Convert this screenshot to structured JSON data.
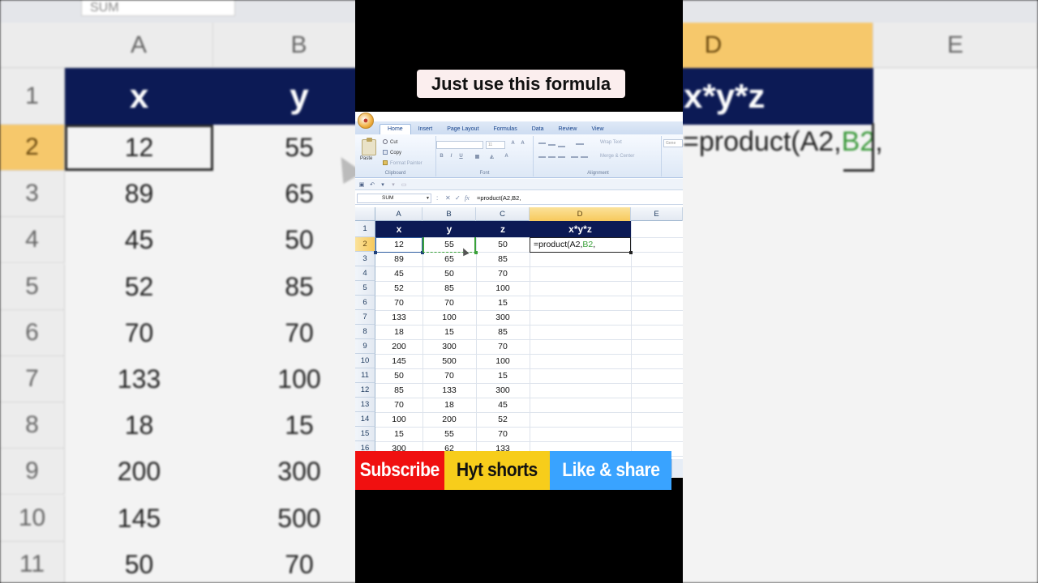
{
  "caption": "Just use this formula",
  "ribbon": {
    "tabs": [
      "Home",
      "Insert",
      "Page Layout",
      "Formulas",
      "Data",
      "Review",
      "View"
    ],
    "clipboard": {
      "paste_label": "Paste",
      "cut_label": "Cut",
      "copy_label": "Copy",
      "format_painter_label": "Format Painter",
      "group_label": "Clipboard"
    },
    "font": {
      "size_value": "11",
      "group_label": "Font"
    },
    "alignment": {
      "wrap_text_label": "Wrap Text",
      "merge_label": "Merge & Center",
      "group_label": "Alignment"
    },
    "number_format_value": "Gene"
  },
  "formula_bar": {
    "name_box": "SUM",
    "fx_label": "fx",
    "formula": "=product(A2,B2,"
  },
  "sheet": {
    "columns": [
      "A",
      "B",
      "C",
      "D",
      "E"
    ],
    "active_column": "D",
    "active_row": "2",
    "header_row": {
      "a": "x",
      "b": "y",
      "c": "z",
      "d": "x*y*z"
    },
    "editing_cell": {
      "text_prefix": "=product(A2,",
      "text_ref_b": "B2",
      "text_suffix": ","
    },
    "rows": [
      {
        "n": "1"
      },
      {
        "n": "2",
        "a": "12",
        "b": "55",
        "c": "50"
      },
      {
        "n": "3",
        "a": "89",
        "b": "65",
        "c": "85"
      },
      {
        "n": "4",
        "a": "45",
        "b": "50",
        "c": "70"
      },
      {
        "n": "5",
        "a": "52",
        "b": "85",
        "c": "100"
      },
      {
        "n": "6",
        "a": "70",
        "b": "70",
        "c": "15"
      },
      {
        "n": "7",
        "a": "133",
        "b": "100",
        "c": "300"
      },
      {
        "n": "8",
        "a": "18",
        "b": "15",
        "c": "85"
      },
      {
        "n": "9",
        "a": "200",
        "b": "300",
        "c": "70"
      },
      {
        "n": "10",
        "a": "145",
        "b": "500",
        "c": "100"
      },
      {
        "n": "11",
        "a": "50",
        "b": "70",
        "c": "15"
      },
      {
        "n": "12",
        "a": "85",
        "b": "133",
        "c": "300"
      },
      {
        "n": "13",
        "a": "70",
        "b": "18",
        "c": "45"
      },
      {
        "n": "14",
        "a": "100",
        "b": "200",
        "c": "52"
      },
      {
        "n": "15",
        "a": "15",
        "b": "55",
        "c": "70"
      },
      {
        "n": "16",
        "a": "300",
        "b": "62",
        "c": "133"
      }
    ]
  },
  "promo": {
    "subscribe": "Subscribe",
    "channel": "Hyt shorts",
    "like_share": "Like & share"
  },
  "colors": {
    "header_navy": "#0c1a55",
    "active_header": "#f7c95c",
    "subscribe_red": "#f01010",
    "channel_yellow": "#f7cd1b",
    "like_blue": "#39a3ff",
    "ref_green": "#3aa13a"
  }
}
